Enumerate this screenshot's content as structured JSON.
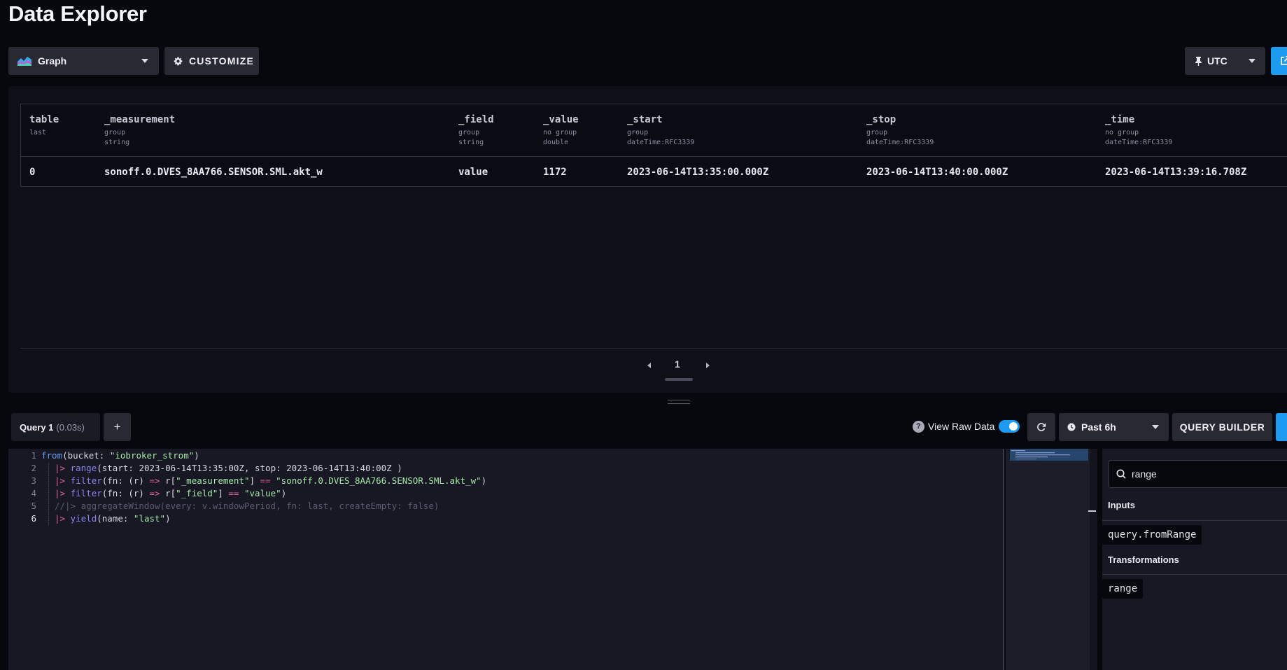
{
  "page": {
    "title": "Data Explorer"
  },
  "toolbar": {
    "visualization": {
      "label": "Graph",
      "icon": "graph-icon"
    },
    "customize_label": "CUSTOMIZE",
    "timezone_label": "UTC"
  },
  "table": {
    "columns": [
      {
        "name": "table",
        "sub1": "last",
        "sub2": ""
      },
      {
        "name": "_measurement",
        "sub1": "group",
        "sub2": "string"
      },
      {
        "name": "_field",
        "sub1": "group",
        "sub2": "string"
      },
      {
        "name": "_value",
        "sub1": "no group",
        "sub2": "double"
      },
      {
        "name": "_start",
        "sub1": "group",
        "sub2": "dateTime:RFC3339"
      },
      {
        "name": "_stop",
        "sub1": "group",
        "sub2": "dateTime:RFC3339"
      },
      {
        "name": "_time",
        "sub1": "no group",
        "sub2": "dateTime:RFC3339"
      }
    ],
    "rows": [
      [
        "0",
        "sonoff.0.DVES_8AA766.SENSOR.SML.akt_w",
        "value",
        "1172",
        "2023-06-14T13:35:00.000Z",
        "2023-06-14T13:40:00.000Z",
        "2023-06-14T13:39:16.708Z"
      ]
    ]
  },
  "pager": {
    "current": "1"
  },
  "query_bar": {
    "tab_label": "Query 1",
    "tab_time": "(0.03s)",
    "add_label": "+",
    "raw_data_label": "View Raw Data",
    "raw_data_enabled": true,
    "time_range_label": "Past 6h",
    "query_builder_label": "QUERY BUILDER"
  },
  "editor": {
    "line_numbers": [
      "1",
      "2",
      "3",
      "4",
      "5",
      "6"
    ],
    "active_line": "6",
    "lines": [
      [
        [
          "kw",
          "from"
        ],
        [
          "p",
          "(bucket: "
        ],
        [
          "str",
          "\"iobroker_strom\""
        ],
        [
          "p",
          ")"
        ]
      ],
      [
        [
          "op",
          "|>"
        ],
        [
          "p",
          " "
        ],
        [
          "fn",
          "range"
        ],
        [
          "p",
          "(start: 2023-06-14T13:35:00Z, stop: 2023-06-14T13:40:00Z )"
        ]
      ],
      [
        [
          "op",
          "|>"
        ],
        [
          "p",
          " "
        ],
        [
          "fn",
          "filter"
        ],
        [
          "p",
          "(fn: (r) "
        ],
        [
          "op",
          "=>"
        ],
        [
          "p",
          " r["
        ],
        [
          "str",
          "\"_measurement\""
        ],
        [
          "p",
          "] "
        ],
        [
          "op",
          "=="
        ],
        [
          "p",
          " "
        ],
        [
          "str",
          "\"sonoff.0.DVES_8AA766.SENSOR.SML.akt_w\""
        ],
        [
          "p",
          ")"
        ]
      ],
      [
        [
          "op",
          "|>"
        ],
        [
          "p",
          " "
        ],
        [
          "fn",
          "filter"
        ],
        [
          "p",
          "(fn: (r) "
        ],
        [
          "op",
          "=>"
        ],
        [
          "p",
          " r["
        ],
        [
          "str",
          "\"_field\""
        ],
        [
          "p",
          "] "
        ],
        [
          "op",
          "=="
        ],
        [
          "p",
          " "
        ],
        [
          "str",
          "\"value\""
        ],
        [
          "p",
          ")"
        ]
      ],
      [
        [
          "cm",
          "//|> aggregateWindow(every: v.windowPeriod, fn: last, createEmpty: false)"
        ]
      ],
      [
        [
          "op",
          "|>"
        ],
        [
          "p",
          " "
        ],
        [
          "fn",
          "yield"
        ],
        [
          "p",
          "(name: "
        ],
        [
          "str",
          "\"last\""
        ],
        [
          "p",
          ")"
        ]
      ]
    ]
  },
  "functions_panel": {
    "search_value": "range",
    "sections": [
      {
        "heading": "Inputs",
        "items": [
          "query.fromRange"
        ]
      },
      {
        "heading": "Transformations",
        "items": [
          "range"
        ]
      }
    ]
  },
  "colors": {
    "accent": "#1d9bf0",
    "background": "#07070e",
    "panel": "#0f0f18"
  }
}
